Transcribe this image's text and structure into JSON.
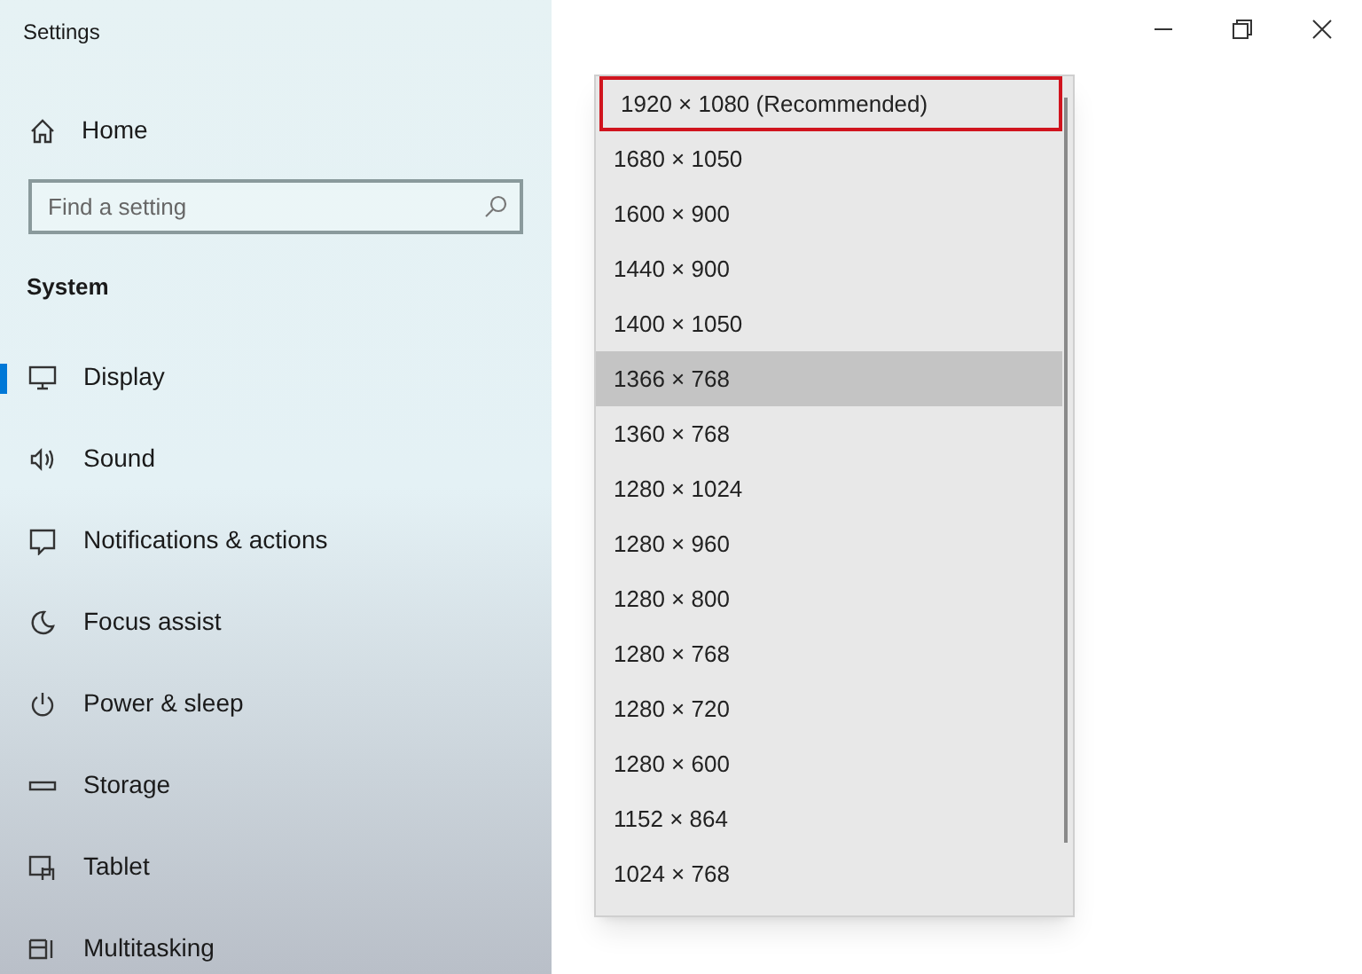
{
  "window": {
    "title": "Settings"
  },
  "sidebar": {
    "home": "Home",
    "search": {
      "placeholder": "Find a setting"
    },
    "section": "System",
    "items": [
      {
        "kind": "display",
        "label": "Display",
        "selected": true
      },
      {
        "kind": "sound",
        "label": "Sound",
        "selected": false
      },
      {
        "kind": "notifications",
        "label": "Notifications & actions",
        "selected": false
      },
      {
        "kind": "focus",
        "label": "Focus assist",
        "selected": false
      },
      {
        "kind": "power",
        "label": "Power & sleep",
        "selected": false
      },
      {
        "kind": "storage",
        "label": "Storage",
        "selected": false
      },
      {
        "kind": "tablet",
        "label": "Tablet",
        "selected": false
      },
      {
        "kind": "multitasking",
        "label": "Multitasking",
        "selected": false
      }
    ]
  },
  "resolution_dropdown": {
    "options": [
      {
        "label": "1920 × 1080 (Recommended)",
        "selected": false,
        "outlined": true
      },
      {
        "label": "1680 × 1050",
        "selected": false,
        "outlined": false
      },
      {
        "label": "1600 × 900",
        "selected": false,
        "outlined": false
      },
      {
        "label": "1440 × 900",
        "selected": false,
        "outlined": false
      },
      {
        "label": "1400 × 1050",
        "selected": false,
        "outlined": false
      },
      {
        "label": "1366 × 768",
        "selected": true,
        "outlined": false
      },
      {
        "label": "1360 × 768",
        "selected": false,
        "outlined": false
      },
      {
        "label": "1280 × 1024",
        "selected": false,
        "outlined": false
      },
      {
        "label": "1280 × 960",
        "selected": false,
        "outlined": false
      },
      {
        "label": "1280 × 800",
        "selected": false,
        "outlined": false
      },
      {
        "label": "1280 × 768",
        "selected": false,
        "outlined": false
      },
      {
        "label": "1280 × 720",
        "selected": false,
        "outlined": false
      },
      {
        "label": "1280 × 600",
        "selected": false,
        "outlined": false
      },
      {
        "label": "1152 × 864",
        "selected": false,
        "outlined": false
      },
      {
        "label": "1024 × 768",
        "selected": false,
        "outlined": false
      }
    ]
  }
}
